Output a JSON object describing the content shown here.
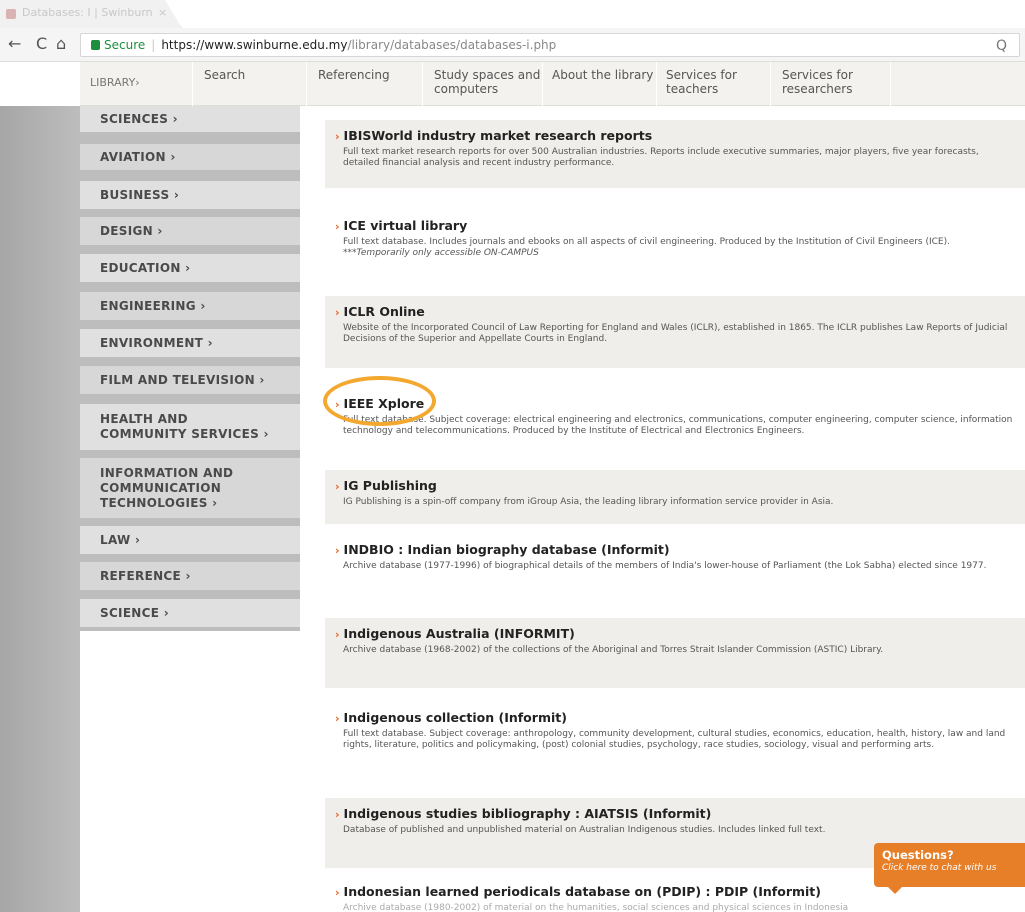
{
  "browser": {
    "tab_title": "Databases: I | Swinburn",
    "tab_close": "×",
    "back": "←",
    "forward": "→",
    "reload": "C",
    "home": "⌂",
    "secure_label": "Secure",
    "separator": "|",
    "url_main": "https://www.swinburne.edu.my",
    "url_path": "/library/databases/databases-i.php",
    "zoom": "Q"
  },
  "sitenav": {
    "items": [
      {
        "label": "LIBRARY›"
      },
      {
        "label": "Search"
      },
      {
        "label": "Referencing"
      },
      {
        "label": "Study spaces and computers"
      },
      {
        "label": "About the library"
      },
      {
        "label": "Services for teachers"
      },
      {
        "label": "Services for researchers"
      }
    ]
  },
  "sidebar": {
    "items": [
      {
        "label": "SCIENCES ›"
      },
      {
        "label": "AVIATION ›"
      },
      {
        "label": "BUSINESS ›"
      },
      {
        "label": "DESIGN ›"
      },
      {
        "label": "EDUCATION ›"
      },
      {
        "label": "ENGINEERING ›"
      },
      {
        "label": "ENVIRONMENT ›"
      },
      {
        "label": "FILM AND TELEVISION ›"
      },
      {
        "label": "HEALTH AND COMMUNITY SERVICES ›"
      },
      {
        "label": "INFORMATION AND COMMUNICATION TECHNOLOGIES ›"
      },
      {
        "label": "LAW ›"
      },
      {
        "label": "REFERENCE ›"
      },
      {
        "label": "SCIENCE ›"
      }
    ]
  },
  "entries": [
    {
      "chev": "›",
      "title": "IBISWorld industry market research reports",
      "desc": "Full text market research reports for over 500 Australian industries. Reports include executive summaries, major players, five year forecasts, detailed financial analysis and recent industry performance."
    },
    {
      "chev": "›",
      "title": "ICE virtual library",
      "desc": "Full text database. Includes journals and ebooks on all aspects of civil engineering. Produced by the Institution of Civil Engineers (ICE).",
      "note": "***Temporarily only accessible ON-CAMPUS"
    },
    {
      "chev": "›",
      "title": "ICLR Online",
      "desc": "Website of the Incorporated Council of Law Reporting for England and Wales (ICLR), established in 1865. The ICLR publishes Law Reports of Judicial Decisions of the Superior and Appellate Courts in England."
    },
    {
      "chev": "›",
      "title": "IEEE Xplore",
      "desc": "Full text database. Subject coverage: electrical engineering and electronics, communications, computer engineering, computer science, information technology and telecommunications. Produced by the Institute of Electrical and Electronics Engineers."
    },
    {
      "chev": "›",
      "title": "IG Publishing",
      "desc": "IG Publishing is a spin-off company from iGroup Asia, the leading library information service provider in Asia."
    },
    {
      "chev": "›",
      "title": "INDBIO : Indian biography database (Informit)",
      "desc": "Archive database (1977-1996) of biographical details of the members of India's lower-house of Parliament (the Lok Sabha) elected since 1977."
    },
    {
      "chev": "›",
      "title": "Indigenous Australia (INFORMIT)",
      "desc": "Archive database (1968-2002) of the collections of the Aboriginal and Torres Strait Islander Commission (ASTIC) Library."
    },
    {
      "chev": "›",
      "title": "Indigenous collection (Informit)",
      "desc": "Full text database. Subject coverage: anthropology, community development, cultural studies, economics, education, health, history, law and land rights, literature, politics and policymaking, (post) colonial studies, psychology, race studies, sociology, visual and performing arts."
    },
    {
      "chev": "›",
      "title": "Indigenous studies bibliography : AIATSIS (Informit)",
      "desc": "Database of published and unpublished material on Australian Indigenous studies. Includes linked full text."
    },
    {
      "chev": "›",
      "title": "Indonesian learned periodicals database on (PDIP) : PDIP (Informit)",
      "desc": "Archive database (1980-2002) of material on the humanities, social sciences and physical sciences in Indonesia"
    }
  ],
  "chat": {
    "title": "Questions?",
    "subtitle": "Click here to chat with us"
  }
}
